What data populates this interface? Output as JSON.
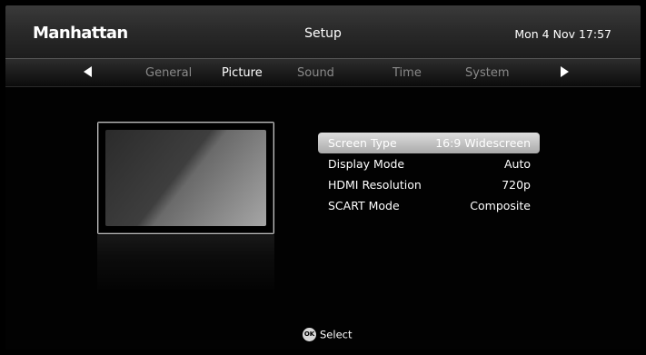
{
  "header": {
    "brand": "Manhattan",
    "title": "Setup",
    "datetime": "Mon 4 Nov 17:57"
  },
  "tabs": [
    {
      "label": "General",
      "active": false
    },
    {
      "label": "Picture",
      "active": true
    },
    {
      "label": "Sound",
      "active": false
    },
    {
      "label": "Time",
      "active": false
    },
    {
      "label": "System",
      "active": false
    }
  ],
  "icons": {
    "prev": "arrow-left-icon",
    "next": "arrow-right-icon",
    "ok": "ok-button-icon"
  },
  "settings": [
    {
      "label": "Screen Type",
      "value": "16:9 Widescreen",
      "selected": true
    },
    {
      "label": "Display Mode",
      "value": "Auto",
      "selected": false
    },
    {
      "label": "HDMI Resolution",
      "value": "720p",
      "selected": false
    },
    {
      "label": "SCART Mode",
      "value": "Composite",
      "selected": false
    }
  ],
  "footer": {
    "ok_badge": "OK",
    "action": "Select"
  }
}
